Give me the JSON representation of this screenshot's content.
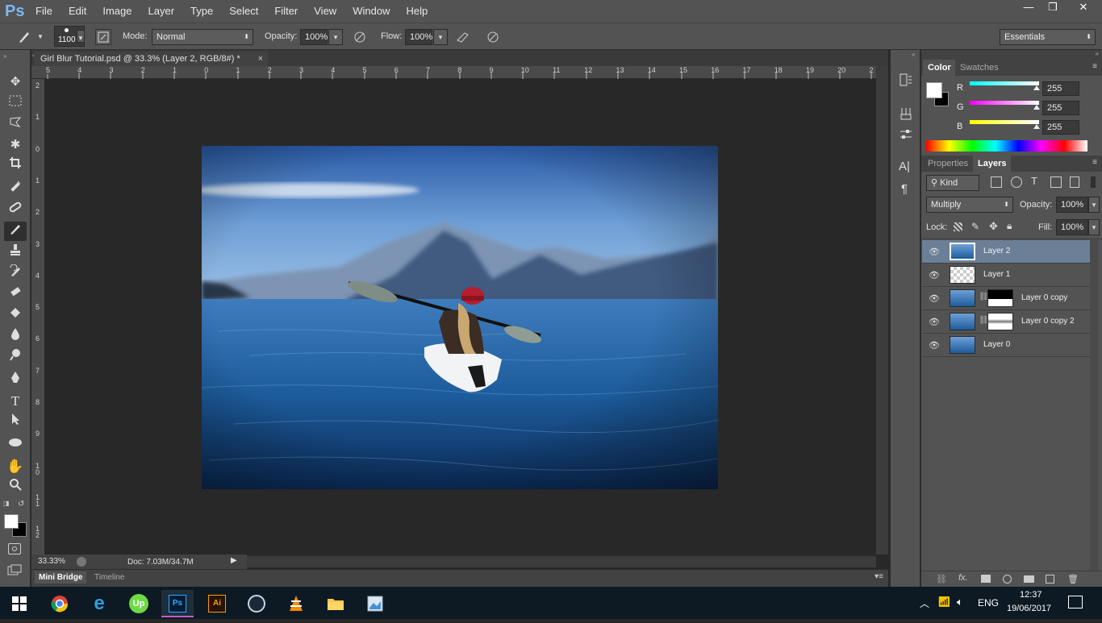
{
  "app": {
    "logo": "Ps"
  },
  "menu": [
    "File",
    "Edit",
    "Image",
    "Layer",
    "Type",
    "Select",
    "Filter",
    "View",
    "Window",
    "Help"
  ],
  "window_controls": {
    "minimize": "—",
    "restore": "❐",
    "close": "✕"
  },
  "options": {
    "brush_size": "1100",
    "mode_label": "Mode:",
    "mode_value": "Normal",
    "opacity_label": "Opacity:",
    "opacity_value": "100%",
    "flow_label": "Flow:",
    "flow_value": "100%",
    "workspace": "Essentials"
  },
  "document": {
    "tab_title": "Girl Blur Tutorial.psd @ 33.3% (Layer 2, RGB/8#) *",
    "close": "×",
    "zoom": "33.33%",
    "doc_info": "Doc: 7.03M/34.7M"
  },
  "ruler_h": [
    "5",
    "4",
    "3",
    "2",
    "1",
    "0",
    "1",
    "2",
    "3",
    "4",
    "5",
    "6",
    "7",
    "8",
    "9",
    "10",
    "11",
    "12",
    "13",
    "14",
    "15",
    "16",
    "17",
    "18",
    "19",
    "20",
    "2"
  ],
  "ruler_v": [
    "2",
    "1",
    "0",
    "1",
    "2",
    "3",
    "4",
    "5",
    "6",
    "7",
    "8",
    "9",
    "1\n0",
    "1\n1",
    "1\n2"
  ],
  "bottom_tabs": {
    "mini_bridge": "Mini Bridge",
    "timeline": "Timeline"
  },
  "color_panel": {
    "tab_color": "Color",
    "tab_swatches": "Swatches",
    "r_label": "R",
    "r_value": "255",
    "g_label": "G",
    "g_value": "255",
    "b_label": "B",
    "b_value": "255"
  },
  "layers_panel": {
    "tab_properties": "Properties",
    "tab_layers": "Layers",
    "filter_kind": "Kind",
    "blend_mode": "Multiply",
    "opacity_label": "Opacity:",
    "opacity_value": "100%",
    "lock_label": "Lock:",
    "fill_label": "Fill:",
    "fill_value": "100%",
    "layers": [
      "Layer 2",
      "Layer 1",
      "Layer 0 copy",
      "Layer 0 copy 2",
      "Layer 0"
    ]
  },
  "taskbar": {
    "language": "ENG",
    "time": "12:37",
    "date": "19/06/2017"
  },
  "colors": {
    "accent_blue": "#6b7f96",
    "chrome": "#535353",
    "canvas_bg": "#282828"
  }
}
